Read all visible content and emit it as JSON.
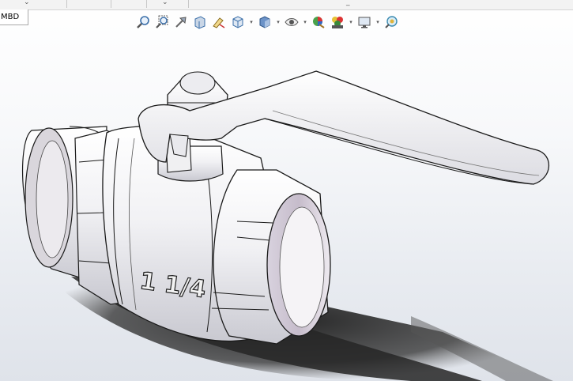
{
  "window": {
    "doc_tab_label": "MBD"
  },
  "toolbar": {
    "buttons": [
      {
        "name": "zoom-to-fit-icon"
      },
      {
        "name": "zoom-to-area-icon"
      },
      {
        "name": "previous-view-icon"
      },
      {
        "name": "section-view-icon"
      },
      {
        "name": "dynamic-annotation-icon"
      },
      {
        "name": "view-orientation-icon",
        "dropdown": true
      },
      {
        "name": "display-style-icon",
        "dropdown": true
      },
      {
        "name": "hide-show-items-icon",
        "dropdown": true
      },
      {
        "name": "edit-appearance-icon"
      },
      {
        "name": "apply-scene-icon",
        "dropdown": true
      },
      {
        "name": "view-settings-icon",
        "dropdown": true
      },
      {
        "name": "realview-icon"
      }
    ]
  },
  "model": {
    "part_marking": "1 1/4"
  },
  "colors": {
    "background_top": "#ffffff",
    "background_bottom": "#dfe3ea",
    "metal_light": "#f4f4f6",
    "metal_shade": "#b9b9c2",
    "edge": "#1a1a1a",
    "shadow": "#2a2a2a"
  }
}
